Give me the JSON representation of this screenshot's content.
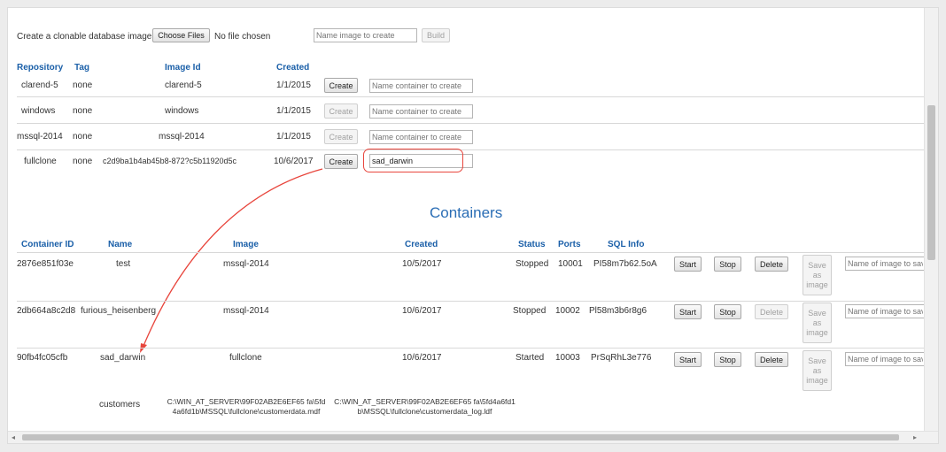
{
  "upload": {
    "label": "Create a clonable database image",
    "choose_files": "Choose Files",
    "no_file": "No file chosen",
    "name_placeholder": "Name image to create",
    "build_label": "Build"
  },
  "images": {
    "headers": {
      "repository": "Repository",
      "tag": "Tag",
      "image_id": "Image Id",
      "created": "Created"
    },
    "create_label": "Create",
    "name_placeholder": "Name container to create",
    "rows": [
      {
        "repository": "clarend-5",
        "tag": "none",
        "image_id": "clarend-5",
        "created": "1/1/2015",
        "input_value": ""
      },
      {
        "repository": "windows",
        "tag": "none",
        "image_id": "windows",
        "created": "1/1/2015",
        "input_value": ""
      },
      {
        "repository": "mssql-2014",
        "tag": "none",
        "image_id": "mssql-2014",
        "created": "1/1/2015",
        "input_value": ""
      },
      {
        "repository": "fullclone",
        "tag": "none",
        "image_id": "c2d9ba1b4ab45b8-872?c5b11920d5c",
        "created": "10/6/2017",
        "input_value": "sad_darwin"
      }
    ]
  },
  "containers": {
    "title": "Containers",
    "headers": {
      "container_id": "Container ID",
      "name": "Name",
      "image": "Image",
      "created": "Created",
      "status": "Status",
      "ports": "Ports",
      "sql_info": "SQL Info"
    },
    "start_label": "Start",
    "stop_label": "Stop",
    "delete_label": "Delete",
    "save_label": "Save as image",
    "name_placeholder": "Name of image to save",
    "rows": [
      {
        "container_id": "2876e851f03e",
        "name": "test",
        "image": "mssql-2014",
        "created": "10/5/2017",
        "status": "Stopped",
        "ports": "10001",
        "sql_info": "PI58m7b62.5oA"
      },
      {
        "container_id": "2db664a8c2d8",
        "name": "furious_heisenberg",
        "image": "mssql-2014",
        "created": "10/6/2017",
        "status": "Stopped",
        "ports": "10002",
        "sql_info": "Pl58m3b6r8g6"
      },
      {
        "container_id": "90fb4fc05cfb",
        "name": "sad_darwin",
        "image": "fullclone",
        "created": "10/6/2017",
        "status": "Started",
        "ports": "10003",
        "sql_info": "PrSqRhL3e776"
      }
    ],
    "extra_row": {
      "label": "customers",
      "mdf_path": "C:\\WIN_AT_SERVER\\99F02AB2E6EF65 fa\\5fd4a6fd1b\\MSSQL\\fullclone\\customerdata.mdf",
      "ldf_path": "C:\\WIN_AT_SERVER\\99F02AB2E6EF65 fa\\5fd4a6fd1b\\MSSQL\\fullclone\\customerdata_log.ldf"
    }
  },
  "colors": {
    "accent": "#1a5fa8",
    "highlight": "#e8453c"
  }
}
